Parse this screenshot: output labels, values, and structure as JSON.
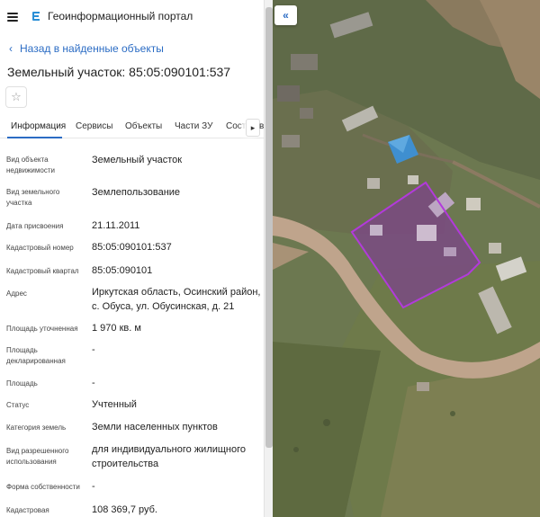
{
  "header": {
    "app_title": "Геоинформационный портал"
  },
  "nav": {
    "back_label": "Назад в найденные объекты"
  },
  "object": {
    "title": "Земельный участок: 85:05:090101:537"
  },
  "tabs": [
    {
      "label": "Информация",
      "active": true
    },
    {
      "label": "Сервисы",
      "active": false
    },
    {
      "label": "Объекты",
      "active": false
    },
    {
      "label": "Части ЗУ",
      "active": false
    },
    {
      "label": "Сост",
      "active": false
    }
  ],
  "tab_overflow": "в",
  "attributes": [
    {
      "label": "Вид объекта недвижимости",
      "value": "Земельный участок"
    },
    {
      "label": "Вид земельного участка",
      "value": "Землепользование"
    },
    {
      "label": "Дата присвоения",
      "value": "21.11.2011"
    },
    {
      "label": "Кадастровый номер",
      "value": "85:05:090101:537"
    },
    {
      "label": "Кадастровый квартал",
      "value": "85:05:090101"
    },
    {
      "label": "Адрес",
      "value": "Иркутская область, Осинский район, с. Обуса, ул. Обусинская, д. 21"
    },
    {
      "label": "Площадь уточненная",
      "value": "1 970 кв. м"
    },
    {
      "label": "Площадь декларированная",
      "value": "-"
    },
    {
      "label": "Площадь",
      "value": "-"
    },
    {
      "label": "Статус",
      "value": "Учтенный"
    },
    {
      "label": "Категория земель",
      "value": "Земли населенных пунктов"
    },
    {
      "label": "Вид разрешенного использования",
      "value": "для индивидуального жилищного строительства"
    },
    {
      "label": "Форма собственности",
      "value": "-"
    },
    {
      "label": "Кадастровая",
      "value": "108 369,7 руб."
    }
  ],
  "map": {
    "collapse_icon": "double-chevron-left-icon",
    "parcel_color": "#b23adb",
    "accent_color": "#2b6cc4"
  }
}
